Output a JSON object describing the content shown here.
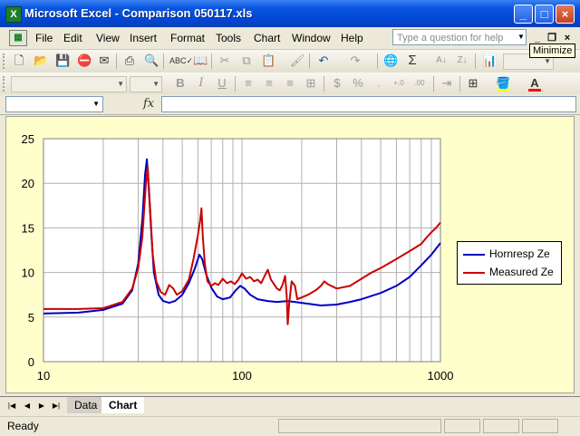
{
  "window": {
    "title": "Microsoft Excel - Comparison 050117.xls",
    "app_icon": "excel-icon",
    "controls": [
      "minimize",
      "maximize",
      "close"
    ]
  },
  "menubar": {
    "items": [
      "File",
      "Edit",
      "View",
      "Insert",
      "Format",
      "Tools",
      "Chart",
      "Window",
      "Help"
    ],
    "help_placeholder": "Type a question for help",
    "tooltip": "Minimize"
  },
  "toolbar": {
    "standard_icons": [
      "new-icon",
      "open-icon",
      "save-icon",
      "permission-icon",
      "email-icon",
      "print-icon",
      "print-preview-icon",
      "spelling-icon",
      "research-icon",
      "cut-icon",
      "copy-icon",
      "paste-icon",
      "format-painter-icon",
      "undo-icon",
      "redo-icon",
      "hyperlink-icon",
      "autosum-icon",
      "sort-ascending-icon",
      "sort-descending-icon",
      "chart-wizard-icon"
    ],
    "format_icons": [
      "bold-icon",
      "italic-icon",
      "underline-icon",
      "align-left-icon",
      "align-center-icon",
      "align-right-icon",
      "merge-center-icon",
      "currency-icon",
      "percent-icon",
      "increase-decimal-icon",
      "decrease-decimal-icon",
      "indent-icon",
      "borders-icon",
      "fill-color-icon",
      "font-color-icon"
    ],
    "fill_color": "#ffff00",
    "font_color": "#ff0000"
  },
  "formula_bar": {
    "name_box": "",
    "fx_label": "fx",
    "formula": ""
  },
  "chart_data": {
    "type": "line",
    "title": "",
    "xlabel": "",
    "ylabel": "",
    "x_scale": "log",
    "xlim": [
      10,
      1000
    ],
    "ylim": [
      0,
      25
    ],
    "x_ticks": [
      "10",
      "100",
      "1000"
    ],
    "y_ticks": [
      "0",
      "5",
      "10",
      "15",
      "20",
      "25"
    ],
    "grid": true,
    "legend_position": "right",
    "background": "#ffffcc",
    "series": [
      {
        "name": "Hornresp Ze",
        "color": "#0000c0",
        "points": [
          [
            10,
            5.4
          ],
          [
            15,
            5.5
          ],
          [
            20,
            5.8
          ],
          [
            25,
            6.5
          ],
          [
            28,
            8.0
          ],
          [
            30,
            11
          ],
          [
            31.5,
            16
          ],
          [
            32.5,
            21
          ],
          [
            33.2,
            22.7
          ],
          [
            34,
            19
          ],
          [
            35,
            14
          ],
          [
            36,
            10
          ],
          [
            38,
            7.5
          ],
          [
            40,
            6.8
          ],
          [
            43,
            6.6
          ],
          [
            46,
            6.8
          ],
          [
            50,
            7.5
          ],
          [
            54,
            8.8
          ],
          [
            58,
            10.5
          ],
          [
            61,
            12
          ],
          [
            63,
            11.5
          ],
          [
            66,
            9.8
          ],
          [
            70,
            8.3
          ],
          [
            75,
            7.3
          ],
          [
            80,
            7.0
          ],
          [
            87,
            7.2
          ],
          [
            93,
            8.0
          ],
          [
            98,
            8.5
          ],
          [
            103,
            8.2
          ],
          [
            110,
            7.5
          ],
          [
            120,
            7.0
          ],
          [
            135,
            6.8
          ],
          [
            150,
            6.7
          ],
          [
            170,
            6.8
          ],
          [
            200,
            6.6
          ],
          [
            250,
            6.3
          ],
          [
            300,
            6.4
          ],
          [
            350,
            6.7
          ],
          [
            400,
            7.0
          ],
          [
            500,
            7.7
          ],
          [
            600,
            8.5
          ],
          [
            700,
            9.5
          ],
          [
            800,
            10.8
          ],
          [
            900,
            12.0
          ],
          [
            1000,
            13.3
          ]
        ]
      },
      {
        "name": "Measured Ze",
        "color": "#cc0000",
        "points": [
          [
            10,
            5.9
          ],
          [
            15,
            5.9
          ],
          [
            20,
            6.0
          ],
          [
            25,
            6.7
          ],
          [
            28,
            8.2
          ],
          [
            30,
            10.5
          ],
          [
            31.5,
            14
          ],
          [
            32.8,
            20
          ],
          [
            33.5,
            21.8
          ],
          [
            34.3,
            18
          ],
          [
            35.5,
            12
          ],
          [
            37,
            9
          ],
          [
            39,
            7.8
          ],
          [
            41,
            7.5
          ],
          [
            43,
            8.6
          ],
          [
            45,
            8.2
          ],
          [
            47,
            7.5
          ],
          [
            50,
            7.9
          ],
          [
            54,
            9.2
          ],
          [
            57,
            11.5
          ],
          [
            60,
            14.2
          ],
          [
            61.5,
            15.8
          ],
          [
            62.5,
            17.2
          ],
          [
            63.5,
            14
          ],
          [
            65,
            11
          ],
          [
            67,
            9
          ],
          [
            70,
            8.5
          ],
          [
            73,
            8.8
          ],
          [
            76,
            8.6
          ],
          [
            80,
            9.3
          ],
          [
            84,
            8.8
          ],
          [
            88,
            9.0
          ],
          [
            92,
            8.7
          ],
          [
            96,
            9.2
          ],
          [
            100,
            9.9
          ],
          [
            105,
            9.3
          ],
          [
            110,
            9.5
          ],
          [
            115,
            9.0
          ],
          [
            120,
            9.2
          ],
          [
            125,
            8.8
          ],
          [
            130,
            9.6
          ],
          [
            135,
            10.3
          ],
          [
            140,
            9.2
          ],
          [
            145,
            8.7
          ],
          [
            150,
            8.2
          ],
          [
            155,
            8.0
          ],
          [
            160,
            8.6
          ],
          [
            165,
            9.6
          ],
          [
            168,
            7.5
          ],
          [
            170,
            4.2
          ],
          [
            173,
            6.5
          ],
          [
            178,
            9.0
          ],
          [
            185,
            8.5
          ],
          [
            190,
            7.0
          ],
          [
            200,
            7.2
          ],
          [
            215,
            7.5
          ],
          [
            235,
            8.0
          ],
          [
            250,
            8.5
          ],
          [
            260,
            9.0
          ],
          [
            270,
            8.7
          ],
          [
            300,
            8.2
          ],
          [
            350,
            8.5
          ],
          [
            400,
            9.3
          ],
          [
            450,
            10.0
          ],
          [
            500,
            10.5
          ],
          [
            600,
            11.5
          ],
          [
            700,
            12.4
          ],
          [
            800,
            13.2
          ],
          [
            850,
            13.9
          ],
          [
            900,
            14.5
          ],
          [
            950,
            15.0
          ],
          [
            1000,
            15.6
          ]
        ]
      }
    ]
  },
  "sheet_tabs": {
    "items": [
      "Data",
      "Chart"
    ],
    "active": "Chart"
  },
  "status": {
    "text": "Ready"
  }
}
